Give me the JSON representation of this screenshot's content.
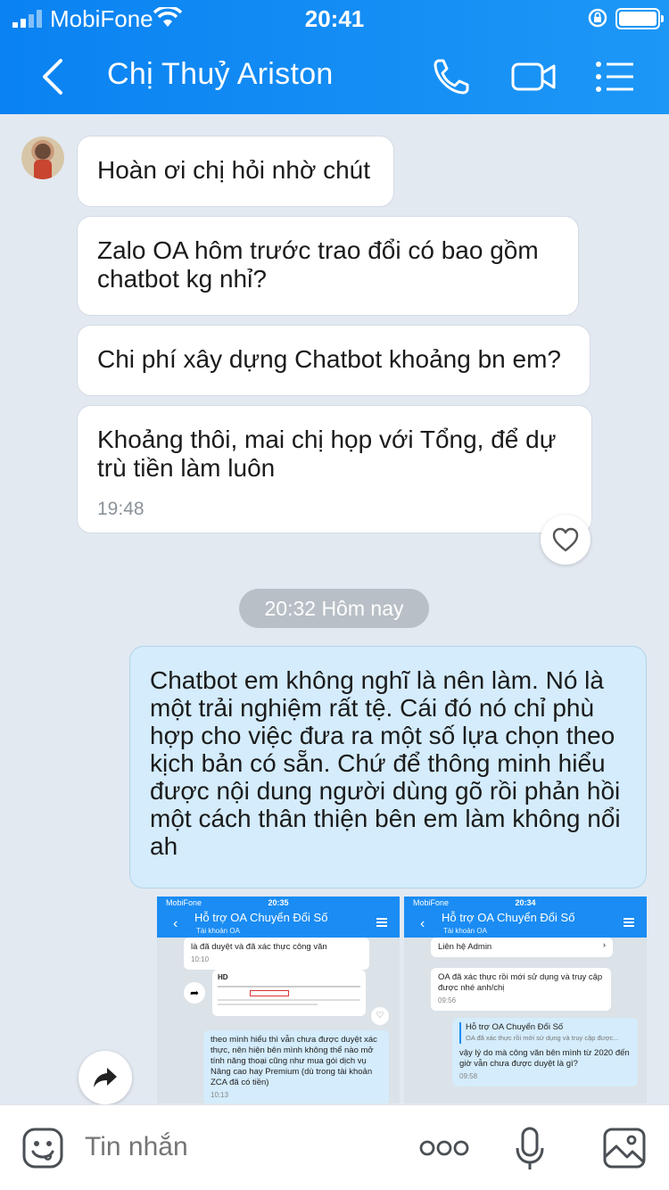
{
  "status_bar": {
    "carrier": "MobiFone",
    "time": "20:41"
  },
  "header": {
    "title": "Chị Thuỷ Ariston"
  },
  "messages_in": [
    {
      "text": "Hoàn ơi chị hỏi nhờ chút"
    },
    {
      "text": "Zalo OA hôm trước trao đổi có bao gồm chatbot kg nhỉ?"
    },
    {
      "text": "Chi phí xây dựng Chatbot khoảng bn em?"
    },
    {
      "text": "Khoảng thôi, mai chị họp với Tổng, để dự trù tiền làm luôn",
      "time": "19:48"
    }
  ],
  "date_separator": "20:32 Hôm nay",
  "message_out": {
    "text": "Chatbot em không nghĩ là nên làm. Nó là một trải nghiệm rất tệ. Cái đó nó chỉ phù hợp cho việc đưa ra một số lựa chọn theo kịch bản có sẵn. Chứ để thông minh hiểu được nội dung người dùng gõ rồi phản hồi một cách thân thiện bên em làm không nổi ah"
  },
  "shots": [
    {
      "carrier": "MobiFone",
      "time": "20:35",
      "title": "Hỗ trợ OA Chuyển Đổi Số",
      "subtitle": "Tài khoản OA",
      "msg1": "là đã duyệt và đã xác thực công văn",
      "msg1_time": "10:10",
      "msg2": "theo mình hiểu thì vẫn chưa được duyệt xác thực, nên hiện bên mình không thể nào mở tính năng thoại cũng như mua gói dịch vụ Nâng cao hay Premium (dù trong tài khoản ZCA đã có tiền)",
      "msg2_time": "10:13",
      "doc_label": "HD"
    },
    {
      "carrier": "MobiFone",
      "time": "20:34",
      "title": "Hỗ trợ OA Chuyển Đổi Số",
      "subtitle": "Tài khoản OA",
      "link": "Liên hệ Admin",
      "msg1": "OA đã xác thực rồi mới sử dụng và truy cập được nhé anh/chị",
      "msg1_time": "09:56",
      "quote_title": "Hỗ trợ OA Chuyển Đổi Số",
      "quote_text": "OA đã xác thực rồi mới sử dụng và truy cập được...",
      "msg2": "vậy lý do mà công văn bên mình từ 2020 đến giờ vẫn chưa được duyệt là gì?",
      "msg2_time": "09:58"
    }
  ],
  "input": {
    "placeholder": "Tin nhắn"
  },
  "colors": {
    "header": "#0a82f2",
    "background": "#e2e9f1",
    "bubble_in": "#ffffff",
    "bubble_out": "#d4ecfb"
  },
  "icons": [
    "back-icon",
    "phone-icon",
    "video-call-icon",
    "menu-icon",
    "heart-icon",
    "forward-icon",
    "emoji-icon",
    "more-icon",
    "microphone-icon",
    "image-icon"
  ]
}
